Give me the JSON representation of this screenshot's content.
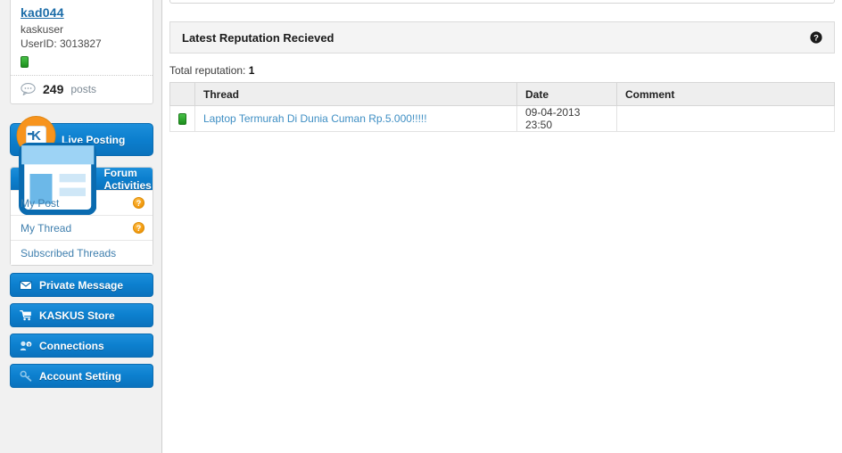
{
  "sidebar": {
    "profile": {
      "username": "kad044",
      "usertitle": "kaskuser",
      "userid_label": "UserID: 3013827",
      "reputation_icon": "green-reputation-block",
      "posts_icon": "speech-bubble-icon",
      "posts_count": "249",
      "posts_label": "posts"
    },
    "live_posting": {
      "label": "Live Posting",
      "badge_icon": "kaskus-pin-badge-icon"
    },
    "forum_activities": {
      "header_label": "Forum Activities",
      "header_icon": "window-layout-icon",
      "items": [
        {
          "label": "My Post",
          "badge": "?",
          "badge_icon": "question-badge-icon"
        },
        {
          "label": "My Thread",
          "badge": "?",
          "badge_icon": "question-badge-icon"
        },
        {
          "label": "Subscribed Threads",
          "badge": "",
          "badge_icon": ""
        }
      ]
    },
    "nav_buttons": [
      {
        "label": "Private Message",
        "icon": "envelope-icon"
      },
      {
        "label": "KASKUS Store",
        "icon": "shopping-cart-icon"
      },
      {
        "label": "Connections",
        "icon": "connections-icon"
      },
      {
        "label": "Account Setting",
        "icon": "wrench-key-icon"
      }
    ]
  },
  "main": {
    "panel_title": "Latest Reputation Recieved",
    "help_icon": "help-question-icon",
    "total_reputation_prefix": "Total reputation: ",
    "total_reputation_value": "1",
    "table": {
      "columns": [
        "Thread",
        "Date",
        "Comment"
      ],
      "rows": [
        {
          "rep_icon": "green-reputation-block",
          "thread": "Laptop Termurah Di Dunia Cuman Rp.5.000!!!!!",
          "date": "09-04-2013 23:50",
          "comment": ""
        }
      ]
    }
  },
  "colors": {
    "brand_blue": "#0c7fce",
    "link_blue": "#3f8fc4",
    "username_blue": "#1b6ca8",
    "badge_orange": "#f39c12",
    "reputation_green": "#2fa72f",
    "sidebar_bg": "#f1f1f1",
    "panel_header_bg": "#f4f4f4",
    "table_header_bg": "#eeeeee"
  }
}
